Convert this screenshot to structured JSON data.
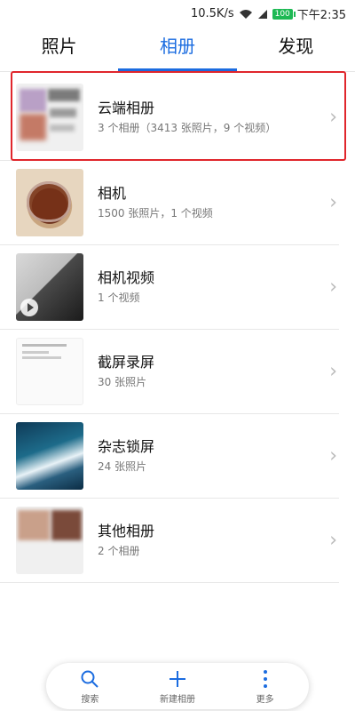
{
  "status_bar": {
    "network_speed": "10.5K/s",
    "battery": "100",
    "time": "下午2:35"
  },
  "tabs": [
    {
      "label": "照片",
      "active": false
    },
    {
      "label": "相册",
      "active": true
    },
    {
      "label": "发现",
      "active": false
    }
  ],
  "albums": [
    {
      "title": "云端相册",
      "subtitle": "3 个相册（3413 张照片，9 个视频）"
    },
    {
      "title": "相机",
      "subtitle": "1500 张照片，1 个视频"
    },
    {
      "title": "相机视频",
      "subtitle": "1 个视频"
    },
    {
      "title": "截屏录屏",
      "subtitle": "30 张照片"
    },
    {
      "title": "杂志锁屏",
      "subtitle": "24 张照片"
    },
    {
      "title": "其他相册",
      "subtitle": "2 个相册"
    }
  ],
  "bottom_bar": {
    "search_label": "搜索",
    "new_album_label": "新建相册",
    "more_label": "更多"
  },
  "colors": {
    "accent": "#1b6ce0",
    "highlight_border": "#e0262c"
  }
}
